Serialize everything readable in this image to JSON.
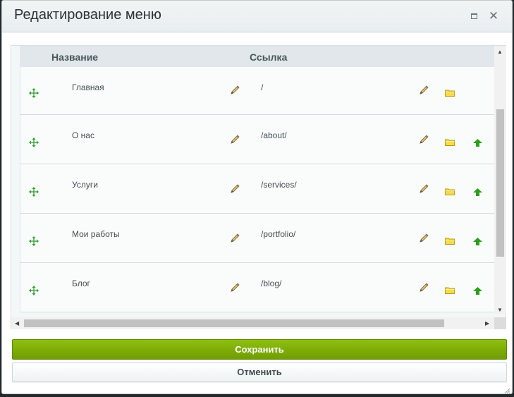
{
  "dialog": {
    "title": "Редактирование меню",
    "maximize_icon": "maximize-icon",
    "close_icon": "close-icon"
  },
  "table": {
    "headers": {
      "name": "Название",
      "link": "Ссылка"
    },
    "rows": [
      {
        "name": "Главная",
        "link": "/"
      },
      {
        "name": "О нас",
        "link": "/about/"
      },
      {
        "name": "Услуги",
        "link": "/services/"
      },
      {
        "name": "Мои работы",
        "link": "/portfolio/"
      },
      {
        "name": "Блог",
        "link": "/blog/"
      }
    ]
  },
  "buttons": {
    "save": "Сохранить",
    "cancel": "Отменить"
  },
  "colors": {
    "save_button": "#7aa80a",
    "move_icon": "#2e9e2e",
    "arrow_icon": "#2c9e1c",
    "folder_icon": "#f0d23a",
    "pencil_icon": "#c8a24a"
  }
}
